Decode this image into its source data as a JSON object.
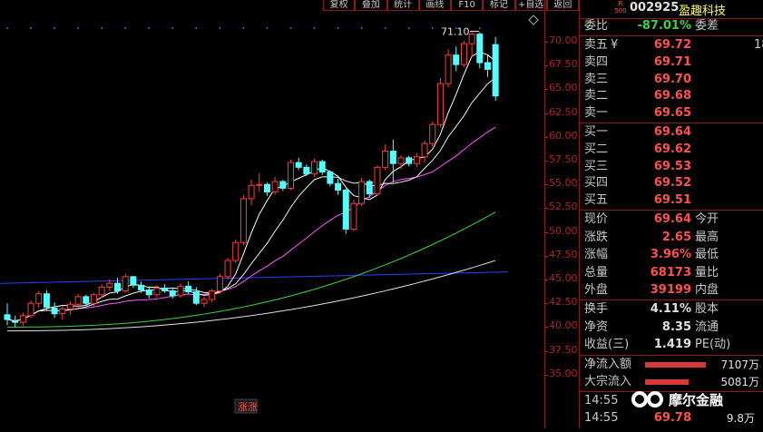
{
  "toolbar": {
    "buttons": [
      "复权",
      "叠加",
      "统计",
      "画线",
      "F10",
      "标记",
      "+自选",
      "返回"
    ]
  },
  "stock": {
    "code": "002925",
    "name": "盈趣科技",
    "badge_top": "R",
    "badge_bottom": "500"
  },
  "chart": {
    "max_label": "71.10",
    "event_label": "涨涨",
    "price_axis": [
      "70.00",
      "67.50",
      "65.00",
      "62.50",
      "60.00",
      "57.50",
      "55.00",
      "52.50",
      "50.00",
      "47.50",
      "45.00",
      "42.50",
      "40.00",
      "37.50",
      "35.00"
    ],
    "colors": {
      "up": "#ff3c3c",
      "down": "#54ffff",
      "ma5": "#ffffff",
      "ma10": "#ffff00",
      "ma20": "#ff55ff",
      "ma60": "#3bd63b",
      "ma120": "#e0e0e0",
      "ref": "#2a3fff"
    }
  },
  "chart_data": {
    "type": "candlestick",
    "ylim": [
      33.5,
      71.5
    ],
    "candles": [
      [
        41.3,
        42.5,
        40.2,
        40.8
      ],
      [
        40.6,
        41.2,
        40.0,
        40.5
      ],
      [
        40.5,
        41.5,
        40.1,
        41.2
      ],
      [
        41.2,
        42.8,
        41.0,
        42.5
      ],
      [
        42.5,
        43.8,
        42.0,
        43.5
      ],
      [
        43.5,
        43.9,
        41.8,
        42.1
      ],
      [
        42.0,
        42.6,
        41.0,
        41.4
      ],
      [
        41.4,
        42.2,
        40.8,
        41.9
      ],
      [
        41.9,
        42.7,
        41.3,
        42.4
      ],
      [
        42.4,
        43.5,
        42.0,
        43.2
      ],
      [
        43.2,
        43.4,
        42.2,
        42.5
      ],
      [
        42.5,
        43.6,
        42.2,
        43.4
      ],
      [
        43.4,
        44.5,
        43.1,
        44.2
      ],
      [
        44.2,
        45.0,
        43.8,
        44.6
      ],
      [
        44.6,
        45.2,
        43.5,
        43.8
      ],
      [
        43.8,
        45.6,
        43.6,
        45.3
      ],
      [
        45.3,
        45.4,
        44.1,
        44.4
      ],
      [
        44.4,
        44.8,
        43.6,
        43.9
      ],
      [
        43.9,
        44.3,
        43.0,
        43.4
      ],
      [
        43.4,
        44.4,
        43.1,
        44.1
      ],
      [
        44.1,
        44.5,
        43.6,
        43.8
      ],
      [
        43.8,
        44.2,
        43.0,
        43.3
      ],
      [
        43.3,
        44.6,
        43.1,
        44.3
      ],
      [
        44.3,
        44.8,
        43.5,
        43.7
      ],
      [
        43.7,
        44.2,
        42.3,
        42.5
      ],
      [
        42.5,
        43.2,
        42.1,
        42.9
      ],
      [
        42.9,
        44.0,
        42.6,
        43.8
      ],
      [
        43.8,
        45.6,
        43.5,
        45.3
      ],
      [
        45.3,
        47.3,
        45.0,
        47.0
      ],
      [
        47.0,
        49.2,
        46.7,
        48.9
      ],
      [
        48.9,
        53.9,
        48.6,
        53.5
      ],
      [
        53.5,
        55.5,
        52.8,
        54.9
      ],
      [
        54.9,
        56.2,
        54.2,
        55.0
      ],
      [
        55.0,
        55.2,
        53.8,
        54.2
      ],
      [
        54.2,
        55.8,
        53.9,
        55.3
      ],
      [
        55.3,
        55.5,
        54.3,
        54.6
      ],
      [
        54.6,
        57.6,
        54.4,
        57.3
      ],
      [
        57.3,
        57.8,
        56.5,
        56.8
      ],
      [
        56.8,
        57.1,
        55.9,
        56.1
      ],
      [
        56.1,
        57.7,
        55.8,
        57.4
      ],
      [
        57.4,
        57.6,
        56.0,
        56.3
      ],
      [
        56.3,
        56.5,
        54.8,
        55.1
      ],
      [
        55.1,
        55.6,
        53.9,
        54.4
      ],
      [
        54.4,
        54.6,
        49.8,
        50.3
      ],
      [
        50.3,
        53.4,
        50.1,
        53.0
      ],
      [
        53.0,
        55.7,
        52.8,
        55.3
      ],
      [
        55.3,
        55.5,
        53.6,
        54.0
      ],
      [
        54.0,
        57.0,
        53.8,
        56.8
      ],
      [
        56.8,
        59.2,
        56.5,
        58.5
      ],
      [
        58.5,
        59.7,
        55.2,
        57.2
      ],
      [
        57.2,
        58.1,
        56.6,
        57.8
      ],
      [
        57.8,
        58.0,
        56.9,
        57.2
      ],
      [
        57.2,
        58.3,
        56.8,
        57.9
      ],
      [
        57.9,
        59.6,
        57.3,
        59.3
      ],
      [
        59.3,
        61.6,
        59.0,
        61.3
      ],
      [
        61.3,
        66.2,
        61.0,
        65.6
      ],
      [
        65.6,
        69.2,
        65.2,
        68.6
      ],
      [
        68.6,
        69.5,
        66.9,
        67.6
      ],
      [
        67.6,
        70.1,
        67.3,
        69.8
      ],
      [
        69.8,
        71.1,
        68.4,
        70.8
      ],
      [
        70.8,
        71.0,
        67.2,
        67.8
      ],
      [
        67.8,
        68.6,
        66.3,
        67.1
      ],
      [
        69.7,
        70.5,
        63.8,
        64.3
      ]
    ]
  },
  "quote": {
    "weibi": {
      "label": "委比",
      "value": "-87.01%",
      "label2": "委差"
    },
    "sell": [
      {
        "label": "卖五",
        "mark": "¥",
        "price": "69.72",
        "extra": "18"
      },
      {
        "label": "卖四",
        "price": "69.71"
      },
      {
        "label": "卖三",
        "price": "69.70"
      },
      {
        "label": "卖二",
        "price": "69.68"
      },
      {
        "label": "卖一",
        "price": "69.65"
      }
    ],
    "buy": [
      {
        "label": "买一",
        "price": "69.64"
      },
      {
        "label": "买二",
        "price": "69.62"
      },
      {
        "label": "买三",
        "price": "69.53"
      },
      {
        "label": "买四",
        "price": "69.52"
      },
      {
        "label": "买五",
        "price": "69.51"
      }
    ],
    "stats": [
      {
        "label": "现价",
        "value": "69.64",
        "label2": "今开",
        "color": "red"
      },
      {
        "label": "涨跌",
        "value": "2.65",
        "label2": "最高",
        "color": "red"
      },
      {
        "label": "涨幅",
        "value": "3.96%",
        "label2": "最低",
        "color": "red"
      },
      {
        "label": "总量",
        "value": "68173",
        "label2": "量比",
        "color": "red"
      },
      {
        "label": "外盘",
        "value": "39199",
        "label2": "内盘",
        "color": "red"
      }
    ],
    "fund": [
      {
        "label": "换手",
        "value": "4.11%",
        "label2": "股本"
      },
      {
        "label": "净资",
        "value": "8.35",
        "label2": "流通"
      },
      {
        "label": "收益(三)",
        "value": "1.419",
        "label2": "PE(动)"
      }
    ],
    "flows": [
      {
        "label": "净流入额",
        "value": "7107万",
        "bar_frac": 1.0
      },
      {
        "label": "大宗流入",
        "value": "5081万",
        "bar_frac": 0.72
      }
    ],
    "ticks": [
      {
        "time": "14:55",
        "price": "",
        "vol": ""
      },
      {
        "time": "14:55",
        "price": "69.78",
        "vol": "9.8万"
      }
    ]
  },
  "logo": {
    "text": "摩尔金融"
  }
}
